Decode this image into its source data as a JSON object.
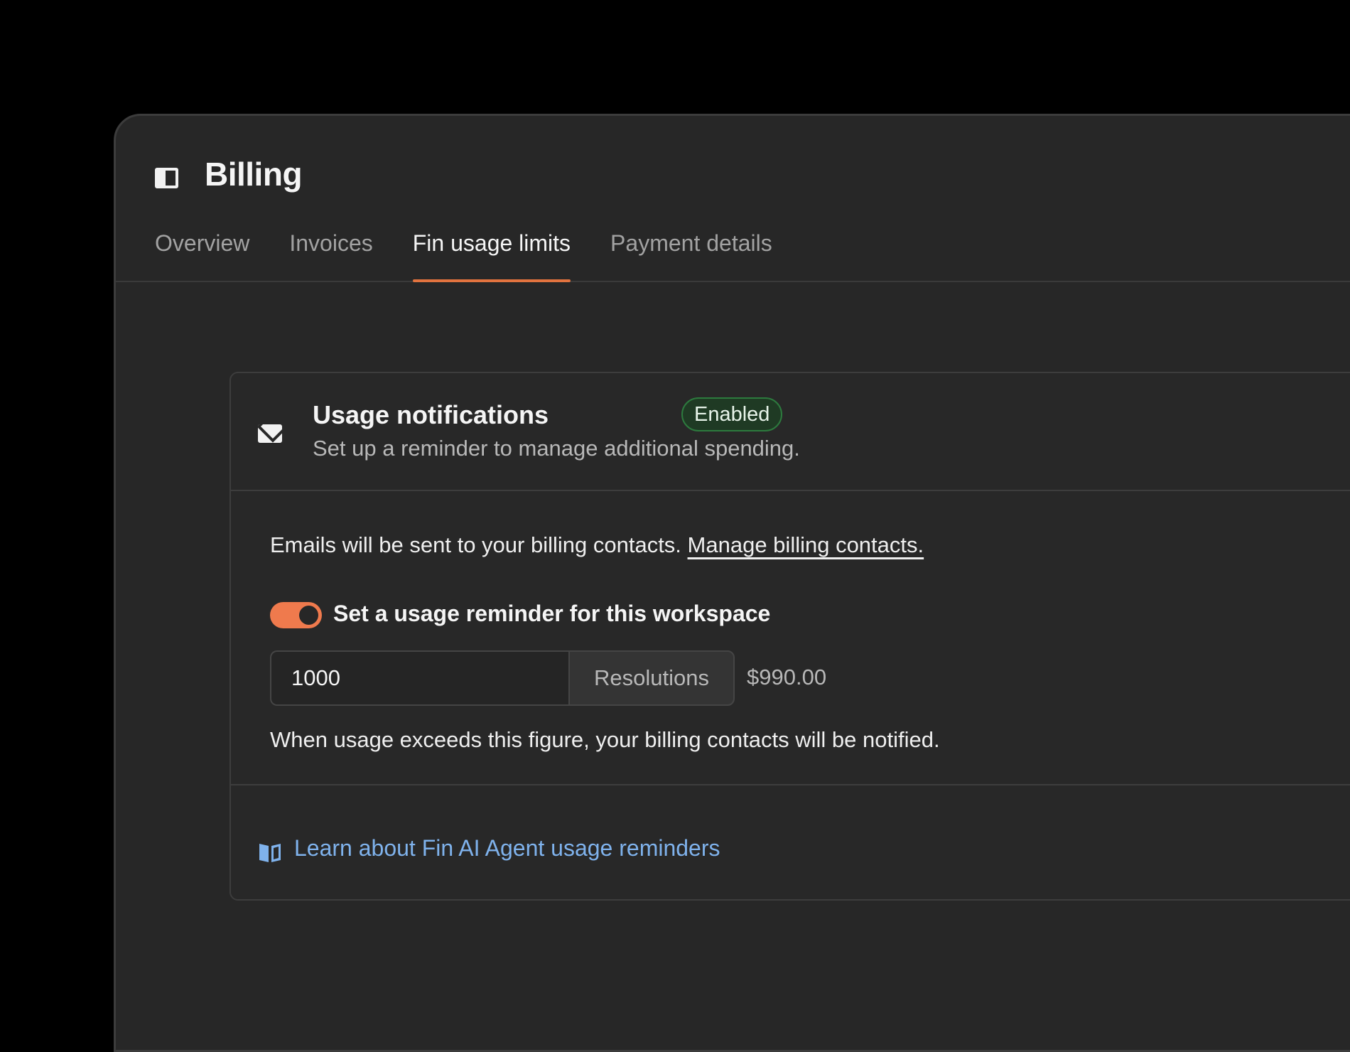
{
  "header": {
    "title": "Billing",
    "tabs": [
      {
        "label": "Overview",
        "active": false
      },
      {
        "label": "Invoices",
        "active": false
      },
      {
        "label": "Fin usage limits",
        "active": true
      },
      {
        "label": "Payment details",
        "active": false
      }
    ]
  },
  "card": {
    "title": "Usage notifications",
    "badge": "Enabled",
    "subtitle": "Set up a reminder to manage additional spending.",
    "info_text": "Emails will be sent to your billing contacts.",
    "manage_link": "Manage billing contacts.",
    "toggle_label": "Set a usage reminder for this workspace",
    "toggle_on": true,
    "input_value": "1000",
    "unit_label": "Resolutions",
    "price": "$990.00",
    "help_text": "When usage exceeds this figure, your billing contacts will be notified.",
    "learn_link": "Learn about Fin AI Agent usage reminders"
  },
  "colors": {
    "accent": "#ef7a4d",
    "badge_bg": "#1f3a24",
    "link": "#7fb2ec",
    "background": "#272727"
  },
  "icons": [
    "panel-icon",
    "mail-icon",
    "book-icon"
  ]
}
